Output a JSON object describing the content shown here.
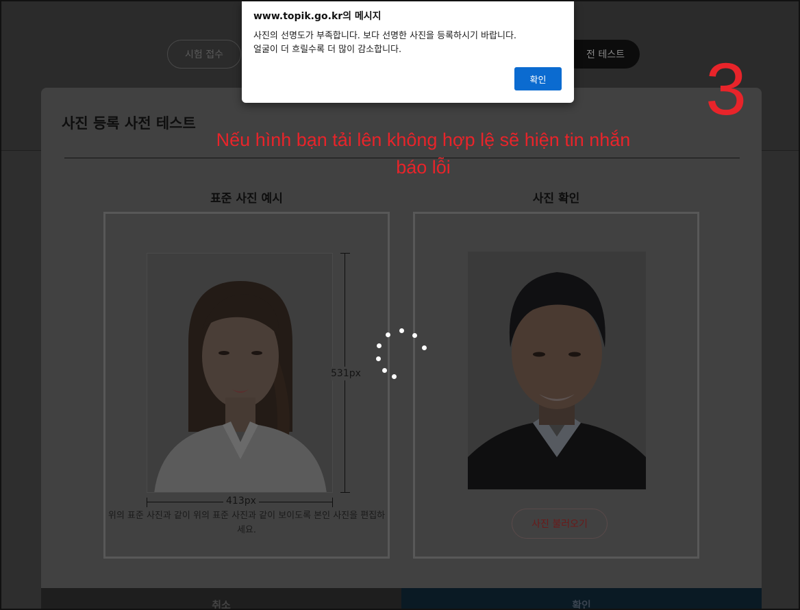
{
  "background": {
    "nav": {
      "apply_label": "시험 접수",
      "test_label": "전 테스트"
    }
  },
  "modal": {
    "title": "사진 등록 사전 테스트",
    "sample": {
      "title": "표준 사진 예시",
      "height_label": "531px",
      "width_label": "413px",
      "description": "위의 표준 사진과 같이 위의 표준 사진과 같이 보이도록 본인 사진을 편집하세요."
    },
    "check": {
      "title": "사진 확인",
      "load_button": "사진 불러오기"
    },
    "footer": {
      "cancel_label": "취소",
      "confirm_label": "확인"
    }
  },
  "annotation": {
    "text": "Nếu hình bạn tải lên không hợp lệ sẽ hiện tin nhắn báo lỗi",
    "step_number": "3",
    "color": "#e8242a"
  },
  "alert": {
    "title": "www.topik.go.kr의 메시지",
    "message_line1": "사진의 선명도가 부족합니다. 보다 선명한 사진을 등록하시기 바랍니다.",
    "message_line2": "얼굴이 더 흐릴수록 더 많이 감소합니다.",
    "ok_label": "확인",
    "accent": "#0b6bd0"
  }
}
